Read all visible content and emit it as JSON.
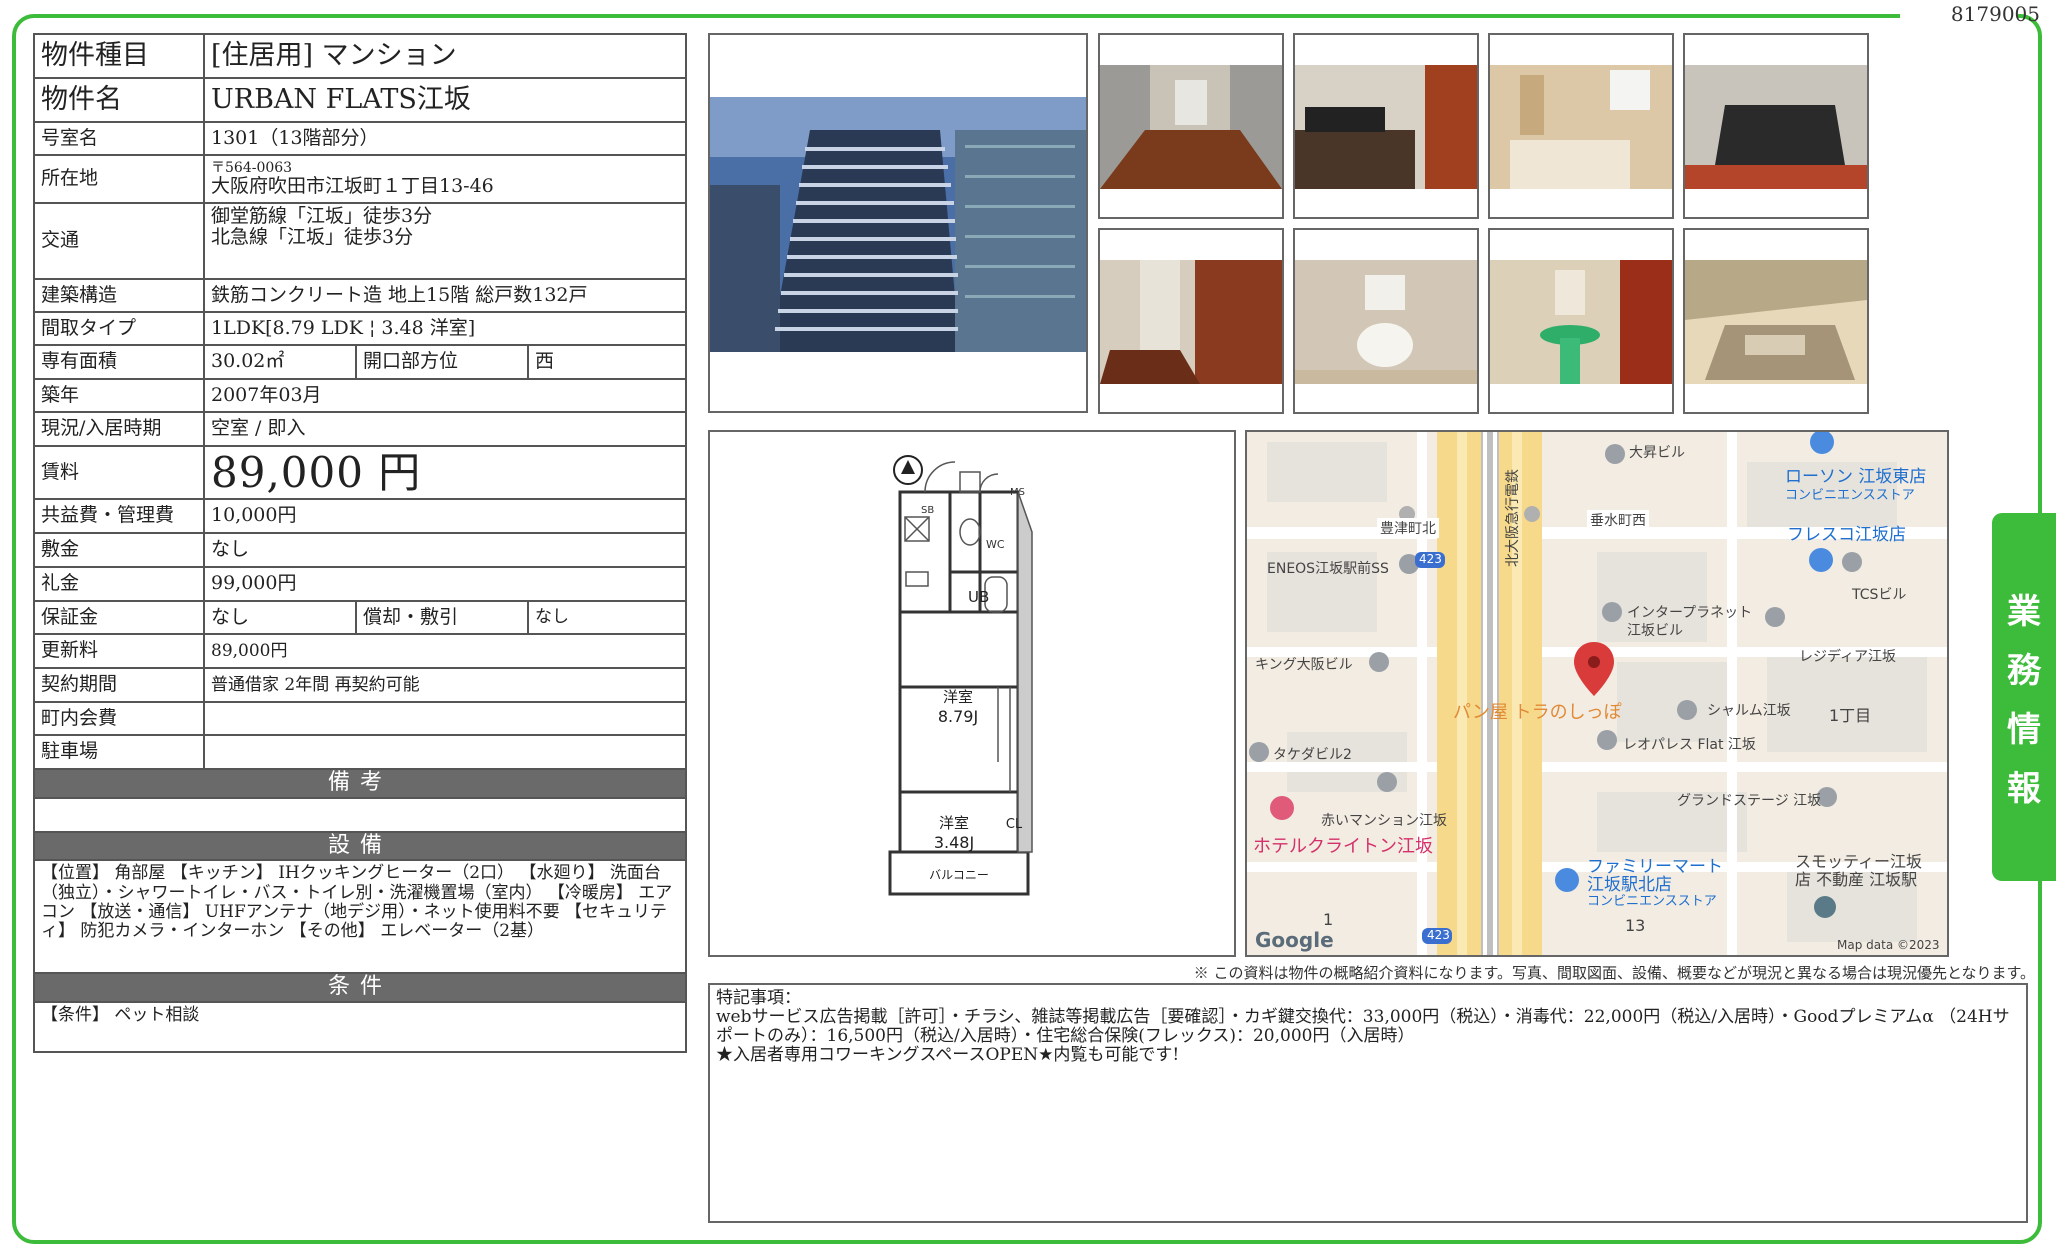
{
  "doc_id": "8179005",
  "spec": {
    "type_label": "物件種目",
    "type_value": "[住居用] マンション",
    "name_label": "物件名",
    "name_value": "URBAN FLATS江坂",
    "room_label": "号室名",
    "room_value": "1301（13階部分）",
    "address_label": "所在地",
    "address_zip": "〒564-0063",
    "address_value": "大阪府吹田市江坂町１丁目13-46",
    "access_label": "交通",
    "access_line1": "御堂筋線「江坂」徒歩3分",
    "access_line2": "北急線「江坂」徒歩3分",
    "structure_label": "建築構造",
    "structure_value": "鉄筋コンクリート造 地上15階 総戸数132戸",
    "layout_label": "間取タイプ",
    "layout_value": "1LDK[8.79 LDK ¦ 3.48 洋室]",
    "area_label": "専有面積",
    "area_value": "30.02㎡",
    "direction_label": "開口部方位",
    "direction_value": "西",
    "built_label": "築年",
    "built_value": "2007年03月",
    "status_label": "現況/入居時期",
    "status_value": "空室 / 即入",
    "rent_label": "賃料",
    "rent_value": "89,000 円",
    "fee_label": "共益費・管理費",
    "fee_value": "10,000円",
    "deposit_label": "敷金",
    "deposit_value": "なし",
    "keymoney_label": "礼金",
    "keymoney_value": "99,000円",
    "guarantee_label": "保証金",
    "guarantee_value": "なし",
    "amort_label": "償却・敷引",
    "amort_value": "なし",
    "renewal_label": "更新料",
    "renewal_value": "89,000円",
    "contract_label": "契約期間",
    "contract_value": "普通借家 2年間 再契約可能",
    "community_label": "町内会費",
    "community_value": "",
    "parking_label": "駐車場",
    "parking_value": ""
  },
  "sections": {
    "remarks_head": "備考",
    "remarks_text": "",
    "equipment_head": "設備",
    "equipment_text": "【位置】 角部屋 【キッチン】 IHクッキングヒーター（2口） 【水廻り】 洗面台（独立）・シャワートイレ・バス・トイレ別・洗濯機置場（室内） 【冷暖房】 エアコン 【放送・通信】 UHFアンテナ（地デジ用）・ネット使用料不要 【セキュリティ】 防犯カメラ・インターホン 【その他】 エレベーター（2基）",
    "conditions_head": "条件",
    "conditions_text": "【条件】 ペット相談"
  },
  "floorplan": {
    "room1_name": "洋室",
    "room1_size": "8.79J",
    "room2_name": "洋室",
    "room2_size": "3.48J",
    "ub": "UB",
    "wc": "WC",
    "cl": "CL",
    "ms": "MS",
    "sb": "SB",
    "balcony": "バルコニー"
  },
  "map": {
    "labels": {
      "taisho": "大昇ビル",
      "lawson": "ローソン 江坂東店",
      "lawson_sub": "コンビニエンスストア",
      "toyotsu": "豊津町北",
      "tarumi": "垂水町西",
      "fresco": "フレスコ江坂店",
      "eneos": "ENEOS江坂駅前SS",
      "rail": "北大阪急行電鉄",
      "route": "423",
      "tcs": "TCSビル",
      "interplanet": "インタープラネット",
      "interplanet2": "江坂ビル",
      "king": "キング大阪ビル",
      "residia": "レジディア江坂",
      "panya": "パン屋 トラのしっぽ",
      "sharm": "シャルム江坂",
      "chome": "1丁目",
      "takeda": "タケダビル2",
      "leopalace": "レオパレス Flat 江坂",
      "akai": "赤いマンション江坂",
      "grand": "グランドステージ 江坂",
      "hotel": "ホテルクライトン江坂",
      "family": "ファミリーマート",
      "family2": "江坂駅北店",
      "family_sub": "コンビニエンスストア",
      "smotty": "スモッティー江坂",
      "smotty2": "店 不動産 江坂駅",
      "num1": "1",
      "num13": "13",
      "google": "Google",
      "mapdata": "Map data ©2023"
    }
  },
  "disclaimer": "※ この資料は物件の概略紹介資料になります。写真、間取図面、設備、概要などが現況と異なる場合は現況優先となります。",
  "notes": "特記事項：\nwebサービス広告掲載［許可］・チラシ、雑誌等掲載広告［要確認］・カギ鍵交換代：33,000円（税込）・消毒代：22,000円（税込/入居時）・Goodプレミアムα （24Hサポートのみ）：16,500円（税込/入居時）・住宅総合保険(フレックス)：20,000円（入居時）\n★入居者専用コワーキングスペースOPEN★内覧も可能です!",
  "side_tab": [
    "業",
    "務",
    "情",
    "報"
  ],
  "colors": {
    "frame_green": "#3dbb3a",
    "header_gray": "#6a6a6a",
    "map_pin": "#d93a3a"
  }
}
